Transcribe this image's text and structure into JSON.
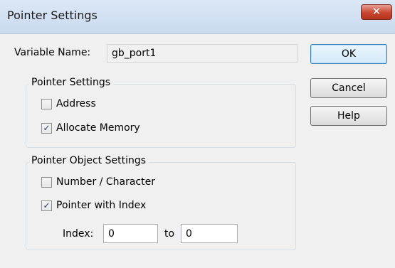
{
  "window": {
    "title": "Pointer Settings",
    "close_glyph": "✕"
  },
  "variable": {
    "label": "Variable Name:",
    "value": "gb_port1"
  },
  "buttons": {
    "ok": "OK",
    "cancel": "Cancel",
    "help": "Help"
  },
  "pointer_settings": {
    "title": "Pointer Settings",
    "address": {
      "label": "Address",
      "checked": false
    },
    "allocate": {
      "label": "Allocate Memory",
      "checked": true
    }
  },
  "object_settings": {
    "title": "Pointer Object Settings",
    "number_char": {
      "label": "Number / Character",
      "checked": false
    },
    "pointer_index": {
      "label": "Pointer with Index",
      "checked": true
    }
  },
  "index": {
    "label": "Index:",
    "from_value": "0",
    "to_label": "to",
    "to_value": "0"
  }
}
